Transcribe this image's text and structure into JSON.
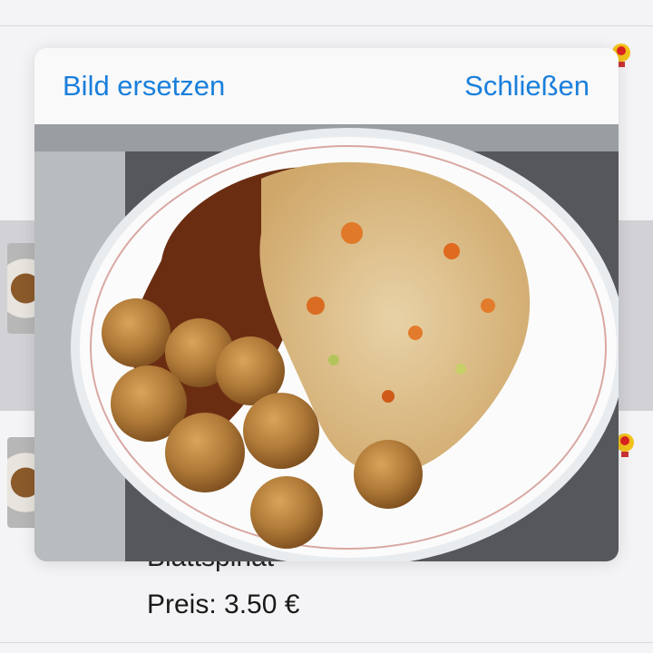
{
  "modal": {
    "replace_label": "Bild ersetzen",
    "close_label": "Schließen"
  },
  "background_item": {
    "name": "Blattspinat",
    "price": "Preis: 3.50 €"
  },
  "colors": {
    "accent": "#1a7fdc",
    "header_bg": "#f9f9fa",
    "background": "#f2f2f4"
  },
  "photo": {
    "icon": "food-photo"
  }
}
